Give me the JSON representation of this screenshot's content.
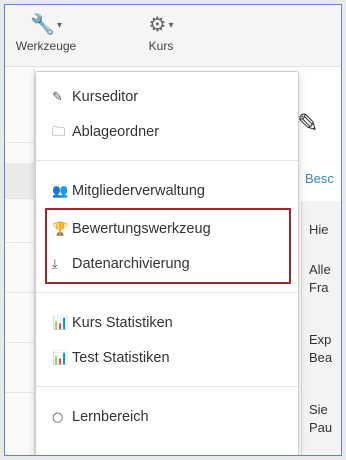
{
  "toolbar": {
    "werkzeuge_label": "Werkzeuge",
    "kurs_label": "Kurs",
    "werkzeuge_icon": "wrench-icon",
    "kurs_icon": "gears-icon",
    "caret": "▾"
  },
  "menu": {
    "items": [
      {
        "label": "Kurseditor",
        "icon": "edit-icon",
        "glyph": "✎"
      },
      {
        "label": "Ablageordner",
        "icon": "folder-icon",
        "glyph": "🗀"
      },
      {
        "label": "Mitgliederverwaltung",
        "icon": "users-icon",
        "glyph": "👥"
      },
      {
        "label": "Bewertungswerkzeug",
        "icon": "trophy-icon",
        "glyph": "🏆"
      },
      {
        "label": "Datenarchivierung",
        "icon": "download-icon",
        "glyph": "⤓"
      },
      {
        "label": "Kurs Statistiken",
        "icon": "bar-chart-icon",
        "glyph": "📊"
      },
      {
        "label": "Test Statistiken",
        "icon": "bar-chart-icon",
        "glyph": "📊"
      },
      {
        "label": "Lernbereich",
        "icon": "circle-icon",
        "glyph": "○"
      }
    ]
  },
  "background": {
    "tab_label": "Besc",
    "lines": [
      "Hie",
      "Alle",
      "Fra",
      "Exp",
      "Bea",
      "Sie",
      "Pau"
    ]
  },
  "colors": {
    "highlight_border": "#a3282d",
    "link": "#3a84c5",
    "window_border": "#5b87c7"
  }
}
